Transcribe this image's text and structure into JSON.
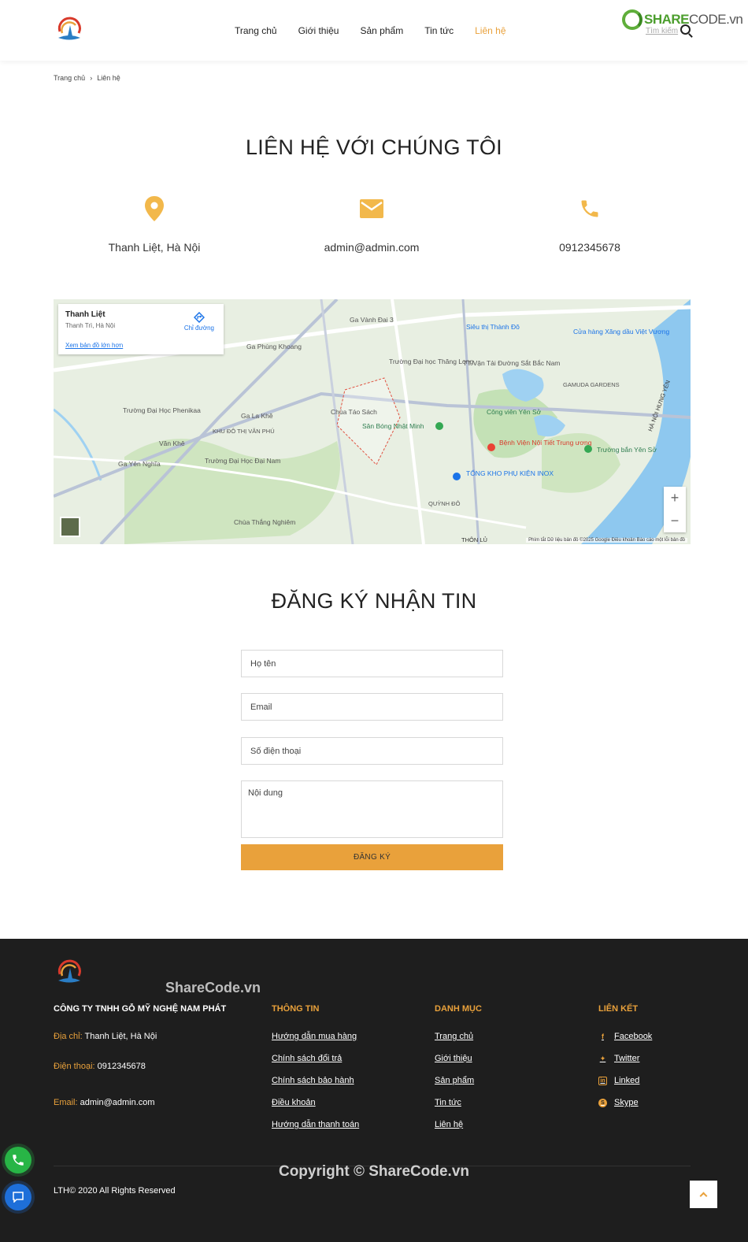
{
  "header": {
    "nav": [
      {
        "label": "Trang chủ",
        "active": false
      },
      {
        "label": "Giới thiệu",
        "active": false
      },
      {
        "label": "Sản phẩm",
        "active": false
      },
      {
        "label": "Tin tức",
        "active": false
      },
      {
        "label": "Liên hệ",
        "active": true
      }
    ],
    "search_label": "Tìm kiếm",
    "watermark_share": "SHARE",
    "watermark_code": "CODE.vn"
  },
  "breadcrumb": {
    "home": "Trang chủ",
    "current": "Liên hệ"
  },
  "contact": {
    "title": "LIÊN HỆ VỚI CHÚNG TÔI",
    "address": "Thanh Liệt, Hà Nội",
    "email": "admin@admin.com",
    "phone": "0912345678",
    "accent_color": "#e9a13b"
  },
  "map": {
    "place_name": "Thanh Liệt",
    "place_sub": "Thanh Trì, Hà Nội",
    "directions": "Chỉ đường",
    "larger_map": "Xem bản đồ lớn hơn",
    "attribution": "Phím tắt   Dữ liệu bản đồ ©2025 Google   Điều khoản   Báo cáo một lỗi bản đồ",
    "labels": [
      "Ga Vành Đai 3",
      "Siêu thị Thành Đô",
      "Cửa hàng Xăng dầu Việt Vương",
      "Ga Phùng Khoang",
      "Trường Đại học Thăng Long",
      "TT Vận Tải Đường Sắt Bắc Nam",
      "Chùa Táo Sách",
      "Sân Bóng Nhật Minh",
      "Công viên Yên Sở",
      "Bệnh Viện Nội Tiết Trung ương",
      "Trường bắn Yên Sở",
      "Trường Đại Học Phenikaa",
      "Ga La Khê",
      "KHU ĐÔ THỊ VĂN PHÚ",
      "Văn Khê",
      "Ga Yên Nghĩa",
      "Trường Đại Học Đại Nam",
      "TỔNG KHO PHỤ KIỆN INOX",
      "QUỲNH ĐÔ",
      "Chùa Thắng Nghiêm",
      "THÔN LỦ",
      "GAMUDA GARDENS",
      "HÀ NỘI HƯNG YÊN"
    ]
  },
  "newsletter": {
    "title": "ĐĂNG KÝ NHẬN TIN",
    "name_placeholder": "Họ tên",
    "email_placeholder": "Email",
    "phone_placeholder": "Số điện thoại",
    "content_placeholder": "Nội dung",
    "submit_label": "ĐĂNG KÝ"
  },
  "footer": {
    "company": "CÔNG TY TNHH GỖ MỸ NGHỆ NAM PHÁT",
    "address_key": "Địa chỉ:",
    "address_val": "Thanh Liệt, Hà Nội",
    "phone_key": "Điện thoại:",
    "phone_val": "0912345678",
    "email_key": "Email:",
    "email_val": "admin@admin.com",
    "info_title": "THÔNG TIN",
    "info_links": [
      "Hướng dẫn mua hàng",
      "Chính sách đổi trả",
      "Chính sách bảo hành",
      "Điều khoản",
      "Hướng dẫn thanh toán"
    ],
    "cat_title": "DANH MỤC",
    "cat_links": [
      "Trang chủ",
      "Giới thiệu",
      "Sản phẩm",
      "Tin tức",
      "Liên hệ"
    ],
    "social_title": "LIÊN KẾT",
    "social_links": [
      {
        "label": "Facebook",
        "icon": "facebook-icon"
      },
      {
        "label": "Twitter",
        "icon": "twitter-icon"
      },
      {
        "label": "Linked",
        "icon": "linkedin-icon"
      },
      {
        "label": "Skype",
        "icon": "skype-icon"
      }
    ],
    "rights": "LTH© 2020 All Rights Reserved",
    "watermark_mid": "ShareCode.vn",
    "watermark_copyright": "Copyright © ShareCode.vn"
  }
}
